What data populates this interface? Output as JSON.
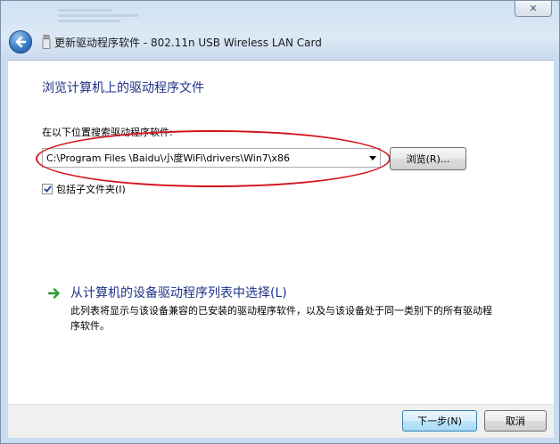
{
  "window": {
    "title": "更新驱动程序软件 - 802.11n USB Wireless LAN Card",
    "close_glyph": "✕"
  },
  "content": {
    "heading": "浏览计算机上的驱动程序文件",
    "search_label": "在以下位置搜索驱动程序软件:",
    "path_value": "C:\\Program Files \\Baidu\\小度WiFi\\drivers\\Win7\\x86",
    "browse_button": "浏览(R)...",
    "include_subfolders": {
      "label": "包括子文件夹(I)",
      "checked": true
    },
    "pick_from_list": {
      "title": "从计算机的设备驱动程序列表中选择(L)",
      "description": "此列表将显示与该设备兼容的已安装的驱动程序软件，以及与该设备处于同一类别下的所有驱动程序软件。"
    }
  },
  "footer": {
    "next_button": "下一步(N)",
    "cancel_button": "取消"
  },
  "colors": {
    "heading_blue": "#1e3287",
    "annotation_red": "#d4141b",
    "arrow_green": "#2e9b2e"
  },
  "icons": {
    "back": "back-arrow-icon",
    "device": "usb-device-icon",
    "dropdown": "chevron-down-icon",
    "link_arrow": "green-arrow-icon",
    "check": "checkmark-icon"
  }
}
